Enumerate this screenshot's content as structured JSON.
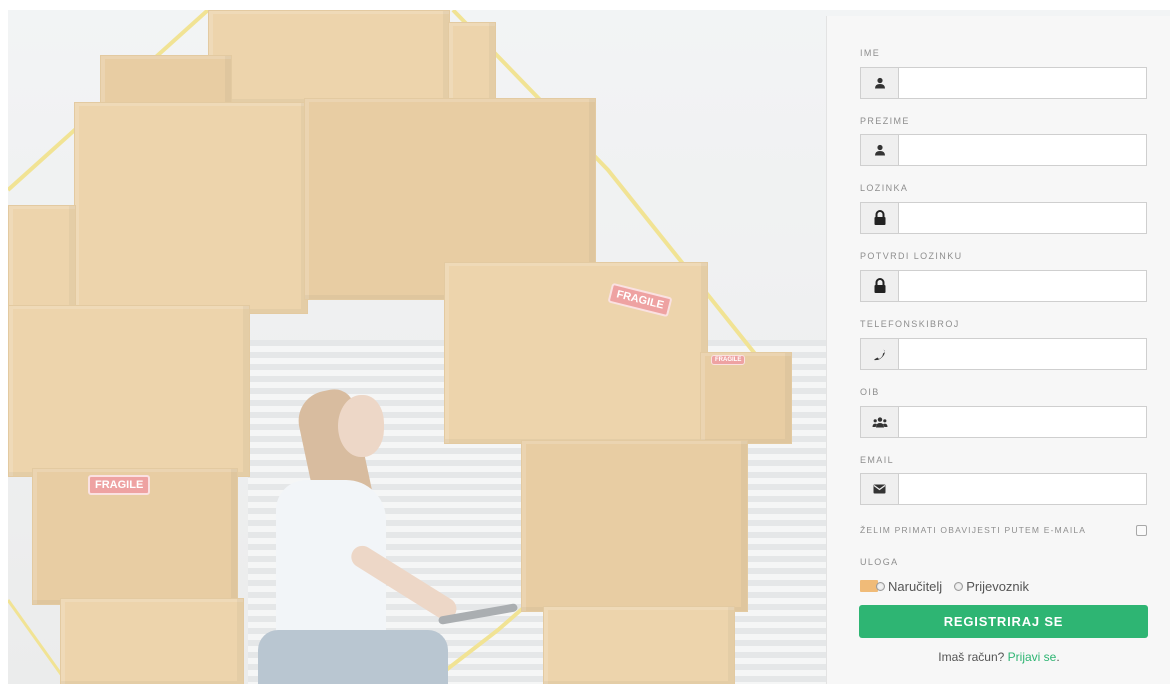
{
  "background": {
    "fragile_labels": [
      "FRAGILE",
      "FRAGILE",
      "FRAGILE"
    ]
  },
  "form": {
    "fields": [
      {
        "label": "IME",
        "icon": "user-icon",
        "value": ""
      },
      {
        "label": "PREZIME",
        "icon": "user-icon",
        "value": ""
      },
      {
        "label": "LOZINKA",
        "icon": "lock-icon",
        "value": ""
      },
      {
        "label": "POTVRDI LOZINKU",
        "icon": "lock-icon",
        "value": ""
      },
      {
        "label": "TELEFONSKIBROJ",
        "icon": "phone-icon",
        "value": ""
      },
      {
        "label": "OIB",
        "icon": "users-icon",
        "value": ""
      },
      {
        "label": "EMAIL",
        "icon": "envelope-icon",
        "value": ""
      }
    ],
    "newsletter_label": "ŽELIM PRIMATI OBAVIJESTI PUTEM E-MAILA",
    "role_label": "ULOGA",
    "roles": [
      "Naručitelj",
      "Prijevoznik"
    ],
    "submit_label": "REGISTRIRAJ SE",
    "login_prompt": "Imaš račun?",
    "login_link": "Prijavi se",
    "login_suffix": ".",
    "colors": {
      "accent": "#2eb573",
      "panel": "#f7f7f7"
    }
  }
}
